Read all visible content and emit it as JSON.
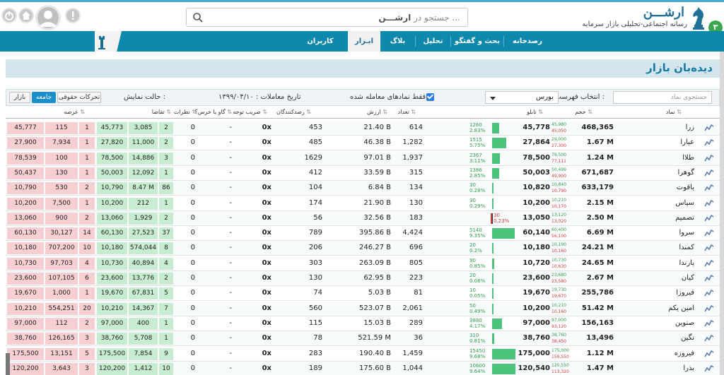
{
  "header": {
    "badge": "۳",
    "logo_title": "ارشـــن",
    "logo_subtitle": "رسانه اجتماعی-تحلیلی بازار سرمایه",
    "search_placeholder_prefix": "جستجو در ",
    "search_placeholder_brand": "ارشـــن",
    "search_placeholder_suffix": " ..."
  },
  "nav": {
    "items": [
      {
        "label": "رصدخانه"
      },
      {
        "label": "بحث و گفتگو"
      },
      {
        "label": "تحلیل"
      },
      {
        "label": "بلاگ"
      },
      {
        "label": "ابـزار"
      },
      {
        "label": "کاربران"
      }
    ],
    "active_index": 4
  },
  "page": {
    "title": "دیده‌بان بازار"
  },
  "controls": {
    "symbol_search_placeholder": "جستجوی نماد",
    "list_label": "انتخاب فهرست :",
    "list_value": "بورس",
    "traded_only_label": "فقط نمادهای معامله شده",
    "trade_date_label": "تاریخ معاملات : ۱۳۹۹/۰۴/۱۰",
    "display_mode_label": "حالت نمایش :",
    "btn_market": "بازار",
    "btn_overall": "جامعه",
    "btn_rights": "تحرکات حقوقی"
  },
  "table": {
    "headers": {
      "symbol": "نماد",
      "volume": "حجم",
      "board": "تابلو",
      "count": "تعداد",
      "value": "ارزش",
      "observers": "رصدکنندگان",
      "attention": "ضریب توجه",
      "talk": "گاو یا خرس؟",
      "opinions": "نظرات",
      "demand": "تقاضا",
      "supply": "عرضه"
    },
    "rows": [
      {
        "symbol": "زرا",
        "volume": "468,365",
        "price": "45,778",
        "up": "45,980",
        "dn": "45,050",
        "chg": "1260",
        "pct": "2.83%",
        "pct_value": 2.83,
        "count": "614",
        "value": "21.40 B",
        "observers": "453",
        "attention": "0x",
        "talk": "-",
        "opinions": "0",
        "dem_n": "2",
        "dem_v": "3,085",
        "dem_p": "45,773",
        "sup_p": "45,777",
        "sup_v": "115",
        "sup_n": "1"
      },
      {
        "symbol": "عیارا",
        "volume": "1.67 M",
        "price": "27,864",
        "up": "29,000",
        "dn": "27,300",
        "chg": "1515",
        "pct": "5.75%",
        "pct_value": 5.75,
        "count": "1,282",
        "value": "46.38 B",
        "observers": "485",
        "attention": "0x",
        "talk": "-",
        "opinions": "0",
        "dem_n": "2",
        "dem_v": "11,000",
        "dem_p": "27,820",
        "sup_p": "27,900",
        "sup_v": "7,934",
        "sup_n": "1"
      },
      {
        "symbol": "طلاا",
        "volume": "1.24 M",
        "price": "78,500",
        "up": "79,500",
        "dn": "77,111",
        "chg": "2367",
        "pct": "3.11%",
        "pct_value": 3.11,
        "count": "1,937",
        "value": "97.01 B",
        "observers": "1629",
        "attention": "0x",
        "talk": "-",
        "opinions": "0",
        "dem_n": "3",
        "dem_v": "14,886",
        "dem_p": "78,500",
        "sup_p": "78,539",
        "sup_v": "100",
        "sup_n": "1"
      },
      {
        "symbol": "گوهرا",
        "volume": "671,687",
        "price": "50,003",
        "up": "50,499",
        "dn": "49,900",
        "chg": "1386",
        "pct": "2.85%",
        "pct_value": 2.85,
        "count": "315",
        "value": "33.59 B",
        "observers": "412",
        "attention": "0x",
        "talk": "-",
        "opinions": "0",
        "dem_n": "1",
        "dem_v": "12,092",
        "dem_p": "50,003",
        "sup_p": "50,437",
        "sup_v": "130",
        "sup_n": "1"
      },
      {
        "symbol": "یاقوت",
        "volume": "633,179",
        "price": "10,820",
        "up": "10,840",
        "dn": "10,790",
        "chg": "30",
        "pct": "0.28%",
        "pct_value": 0.28,
        "count": "134",
        "value": "6.84 B",
        "observers": "104",
        "attention": "0x",
        "talk": "-",
        "opinions": "0",
        "dem_n": "86",
        "dem_v": "8.47 M",
        "dem_p": "10,790",
        "sup_p": "10,790",
        "sup_v": "530",
        "sup_n": "2"
      },
      {
        "symbol": "سپاس",
        "volume": "2.15 M",
        "price": "10,200",
        "up": "10,210",
        "dn": "10,170",
        "chg": "30",
        "pct": "0.29%",
        "pct_value": 0.29,
        "count": "130",
        "value": "21.90 B",
        "observers": "174",
        "attention": "0x",
        "talk": "-",
        "opinions": "0",
        "dem_n": "1",
        "dem_v": "212",
        "dem_p": "10,200",
        "sup_p": "10,200",
        "sup_v": "7,500",
        "sup_n": "1"
      },
      {
        "symbol": "تصمیم",
        "volume": "2.50 M",
        "price": "13,050",
        "up": "13,120",
        "dn": "13,020",
        "chg": "30",
        "pct": "0.23%",
        "pct_value": -0.23,
        "count": "183",
        "value": "32.56 B",
        "observers": "56",
        "attention": "0x",
        "talk": "-",
        "opinions": "0",
        "dem_n": "2",
        "dem_v": "1,929",
        "dem_p": "13,060",
        "sup_p": "13,060",
        "sup_v": "900",
        "sup_n": "2"
      },
      {
        "symbol": "سروا",
        "volume": "6.69 M",
        "price": "60,140",
        "up": "60,400",
        "dn": "56,100",
        "chg": "5140",
        "pct": "9.35%",
        "pct_value": 9.35,
        "count": "4,424",
        "value": "395.86 B",
        "observers": "789",
        "attention": "0x",
        "talk": "-",
        "opinions": "0",
        "dem_n": "37",
        "dem_v": "27,523",
        "dem_p": "60,130",
        "sup_p": "60,130",
        "sup_v": "30,127",
        "sup_n": "14"
      },
      {
        "symbol": "کمندا",
        "volume": "24.21 M",
        "price": "10,180",
        "up": "10,190",
        "dn": "10,160",
        "chg": "20",
        "pct": "0.2%",
        "pct_value": 0.2,
        "count": "696",
        "value": "246.27 B",
        "observers": "206",
        "attention": "0x",
        "talk": "-",
        "opinions": "0",
        "dem_n": "8",
        "dem_v": "574,044",
        "dem_p": "10,180",
        "sup_p": "10,180",
        "sup_v": "707,200",
        "sup_n": "10"
      },
      {
        "symbol": "پارندا",
        "volume": "24.65 M",
        "price": "10,720",
        "up": "10,730",
        "dn": "10,630",
        "chg": "90",
        "pct": "0.85%",
        "pct_value": 0.85,
        "count": "805",
        "value": "263.09 B",
        "observers": "303",
        "attention": "0x",
        "talk": "-",
        "opinions": "0",
        "dem_n": "4",
        "dem_v": "40,894",
        "dem_p": "10,730",
        "sup_p": "10,730",
        "sup_v": "97,703",
        "sup_n": "4"
      },
      {
        "symbol": "کیان",
        "volume": "2.67 M",
        "price": "23,600",
        "up": "23,680",
        "dn": "23,580",
        "chg": "20",
        "pct": "0.08%",
        "pct_value": 0.08,
        "count": "223",
        "value": "62.95 B",
        "observers": "130",
        "attention": "0x",
        "talk": "-",
        "opinions": "0",
        "dem_n": "2",
        "dem_v": "13,776",
        "dem_p": "23,600",
        "sup_p": "23,600",
        "sup_v": "107,105",
        "sup_n": "6"
      },
      {
        "symbol": "فیروزا",
        "volume": "255,786",
        "price": "19,670",
        "up": "19,730",
        "dn": "19,670",
        "chg": "10",
        "pct": "0.05%",
        "pct_value": 0.05,
        "count": "81",
        "value": "5.03 B",
        "observers": "74",
        "attention": "0x",
        "talk": "-",
        "opinions": "0",
        "dem_n": "5",
        "dem_v": "67,831",
        "dem_p": "19,670",
        "sup_p": "19,670",
        "sup_v": "1,000",
        "sup_n": "1"
      },
      {
        "symbol": "امین یکم",
        "volume": "51.42 M",
        "price": "10,200",
        "up": "10,210",
        "dn": "10,160",
        "chg": "50",
        "pct": "0.49%",
        "pct_value": 0.49,
        "count": "2,061",
        "value": "523.07 B",
        "observers": "560",
        "attention": "0x",
        "talk": "-",
        "opinions": "0",
        "dem_n": "7",
        "dem_v": "14,367",
        "dem_p": "10,210",
        "sup_p": "10,210",
        "sup_v": "554,251",
        "sup_n": "20"
      },
      {
        "symbol": "صنوین",
        "volume": "156,163",
        "price": "97,000",
        "up": "97,000",
        "dn": "93,120",
        "chg": "3880",
        "pct": "4.17%",
        "pct_value": 4.17,
        "count": "289",
        "value": "15.03 B",
        "observers": "115",
        "attention": "0x",
        "talk": "-",
        "opinions": "0",
        "dem_n": "1",
        "dem_v": "400",
        "dem_p": "97,000",
        "sup_p": "97,000",
        "sup_v": "112",
        "sup_n": "2"
      },
      {
        "symbol": "نگین",
        "volume": "13,496",
        "price": "38,760",
        "up": "38,760",
        "dn": "38,450",
        "chg": "310",
        "pct": "0.81%",
        "pct_value": 0.81,
        "count": "36",
        "value": "521.59 M",
        "observers": "78",
        "attention": "0x",
        "talk": "-",
        "opinions": "0",
        "dem_n": "1",
        "dem_v": "5,708",
        "dem_p": "38,760",
        "sup_p": "38,760",
        "sup_v": "126,165",
        "sup_n": "3"
      },
      {
        "symbol": "فیروزه",
        "volume": "1.12 M",
        "price": "175,000",
        "up": "175,000",
        "dn": "159,550",
        "chg": "15450",
        "pct": "9.68%",
        "pct_value": 9.68,
        "count": "1,459",
        "value": "190.40 B",
        "observers": "283",
        "attention": "0x",
        "talk": "-",
        "opinions": "0",
        "dem_n": "9",
        "dem_v": "7,854",
        "dem_p": "175,500",
        "sup_p": "175,500",
        "sup_v": "13,151",
        "sup_n": "5"
      },
      {
        "symbol": "بذرا",
        "volume": "1.47 M",
        "price": "120,540",
        "up": "120,550",
        "dn": "113,320",
        "chg": "10600",
        "pct": "9.64%",
        "pct_value": 9.64,
        "count": "1,044",
        "value": "175.60 B",
        "observers": "189",
        "attention": "0x",
        "talk": "-",
        "opinions": "0",
        "dem_n": "10",
        "dem_v": "1,412",
        "dem_p": "120,200",
        "sup_p": "120,200",
        "sup_v": "3,643",
        "sup_n": "3"
      }
    ]
  },
  "colors": {
    "accent": "#0f88ad",
    "title_band": "#d3e6ee",
    "demand_bg": "#c7ecd2",
    "supply_bg": "#f6cfd2",
    "up": "#2f9d4a",
    "down": "#d13b3b"
  },
  "icons": {
    "logo": "knight-chess-icon",
    "search": "search-icon",
    "info": "exclamation-icon",
    "user": "user-avatar-icon",
    "home": "home-icon",
    "power": "power-icon",
    "row_chart": "chart-icon"
  }
}
